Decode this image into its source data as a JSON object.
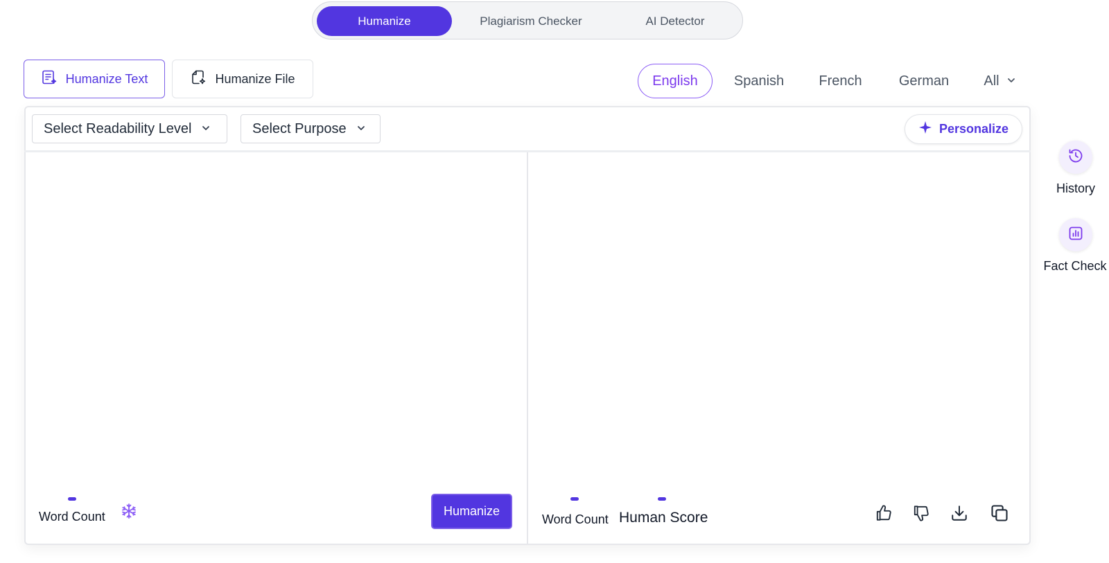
{
  "top_tabs": [
    {
      "label": "Humanize",
      "active": true
    },
    {
      "label": "Plagiarism Checker",
      "active": false
    },
    {
      "label": "AI Detector",
      "active": false
    }
  ],
  "mode_tabs": {
    "text_label": "Humanize Text",
    "file_label": "Humanize File"
  },
  "languages": {
    "items": [
      "English",
      "Spanish",
      "French",
      "German"
    ],
    "all_label": "All",
    "selected": "English"
  },
  "toolbar": {
    "readability_label": "Select Readability Level",
    "purpose_label": "Select Purpose",
    "personalize_label": "Personalize"
  },
  "input_panel": {
    "word_count_label": "Word Count",
    "humanize_button": "Humanize"
  },
  "output_panel": {
    "word_count_label": "Word Count",
    "human_score_label": "Human Score"
  },
  "side_tools": {
    "history_label": "History",
    "fact_check_label": "Fact Check"
  },
  "colors": {
    "accent": "#5236e0",
    "accent_light": "#7c3aed",
    "border": "#e6e7eb"
  }
}
